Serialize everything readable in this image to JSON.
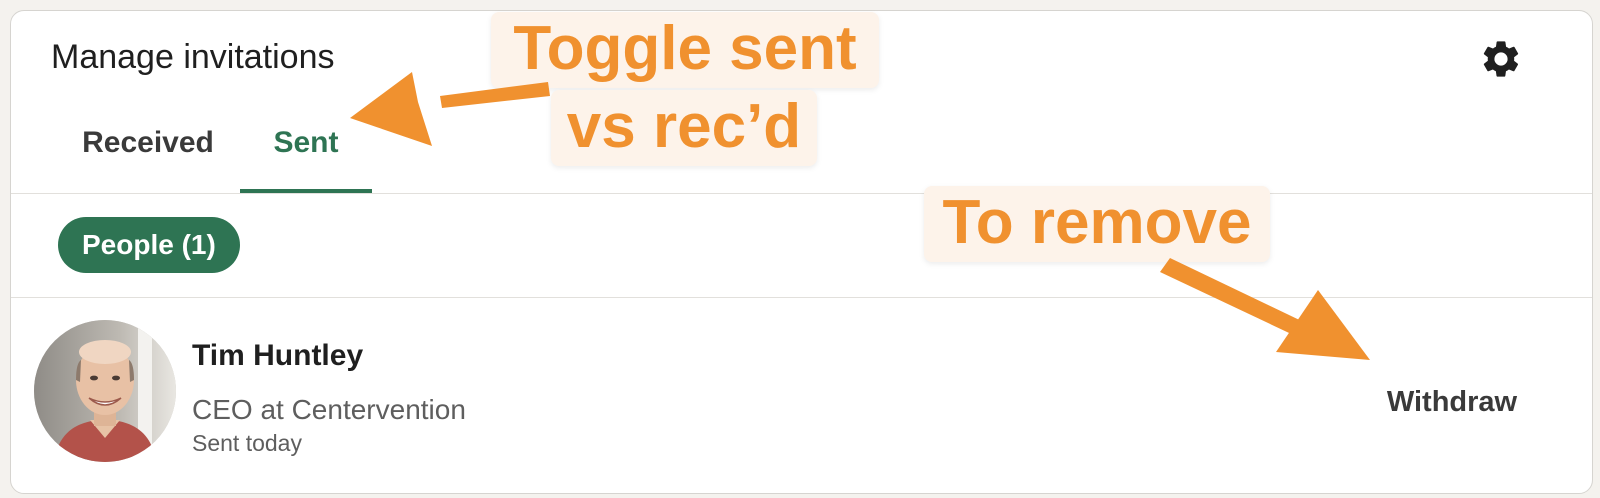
{
  "header": {
    "title": "Manage invitations",
    "settings_icon": "gear-icon"
  },
  "tabs": [
    {
      "label": "Received",
      "active": false
    },
    {
      "label": "Sent",
      "active": true
    }
  ],
  "filter": {
    "label": "People (1)"
  },
  "invitation": {
    "name": "Tim Huntley",
    "headline": "CEO at Centervention",
    "sent": "Sent today",
    "action_label": "Withdraw",
    "avatar_icon": "profile-photo"
  },
  "annotations": {
    "toggle_line1": "Toggle sent",
    "toggle_line2": "vs rec’d",
    "remove": "To remove",
    "color": "#f0912f"
  },
  "colors": {
    "accent": "#2e7453",
    "background": "#f4f2ee",
    "card": "#ffffff"
  }
}
